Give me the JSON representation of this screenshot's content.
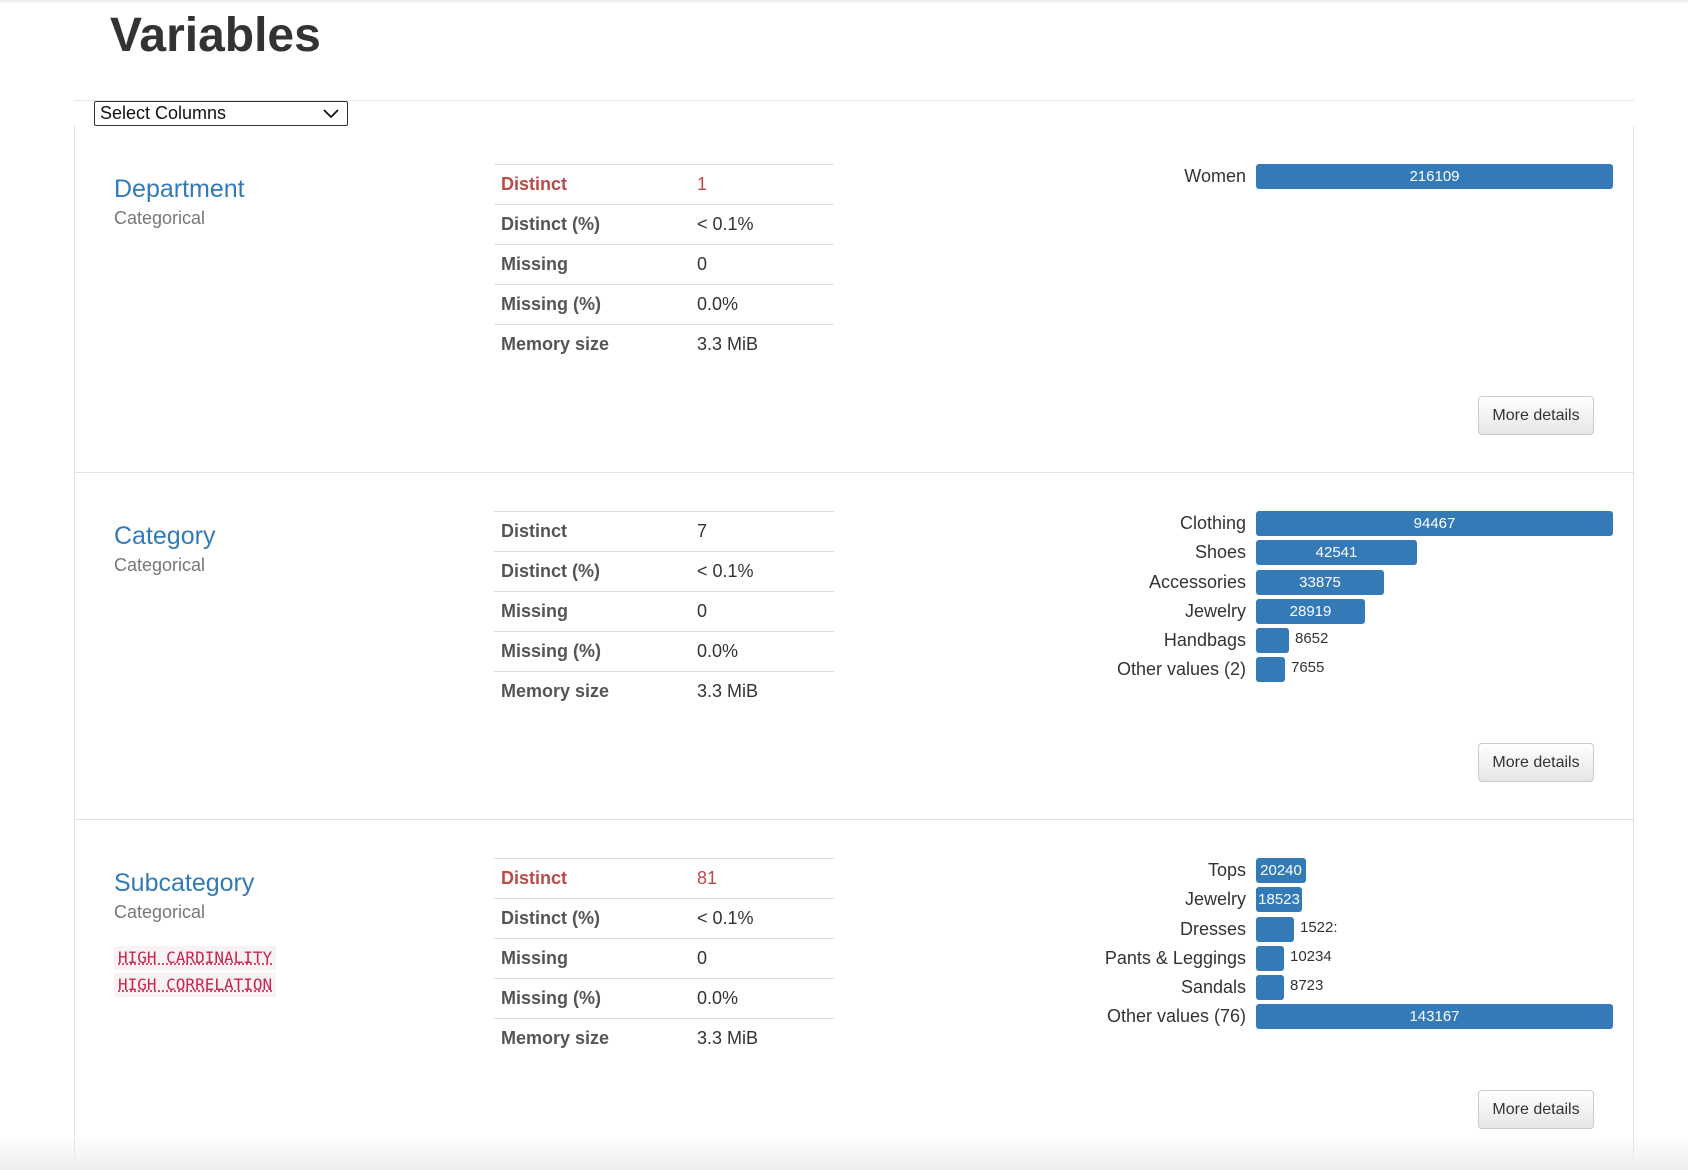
{
  "page": {
    "title": "Variables",
    "select_label": "Select Columns",
    "more_details_label": "More details"
  },
  "colors": {
    "link": "#337ab7",
    "bar": "#337ab7",
    "warning": "#b94a48",
    "alert": "#c7254e"
  },
  "variables": [
    {
      "name": "Department",
      "type": "Categorical",
      "alerts": [],
      "stats": [
        {
          "label": "Distinct",
          "value": "1",
          "warn": true
        },
        {
          "label": "Distinct (%)",
          "value": "< 0.1%",
          "warn": false
        },
        {
          "label": "Missing",
          "value": "0",
          "warn": false
        },
        {
          "label": "Missing (%)",
          "value": "0.0%",
          "warn": false
        },
        {
          "label": "Memory size",
          "value": "3.3 MiB",
          "warn": false
        }
      ],
      "frequencies": [
        {
          "label": "Women",
          "count": 216109,
          "display": "216109"
        }
      ]
    },
    {
      "name": "Category",
      "type": "Categorical",
      "alerts": [],
      "stats": [
        {
          "label": "Distinct",
          "value": "7",
          "warn": false
        },
        {
          "label": "Distinct (%)",
          "value": "< 0.1%",
          "warn": false
        },
        {
          "label": "Missing",
          "value": "0",
          "warn": false
        },
        {
          "label": "Missing (%)",
          "value": "0.0%",
          "warn": false
        },
        {
          "label": "Memory size",
          "value": "3.3 MiB",
          "warn": false
        }
      ],
      "frequencies": [
        {
          "label": "Clothing",
          "count": 94467,
          "display": "94467"
        },
        {
          "label": "Shoes",
          "count": 42541,
          "display": "42541"
        },
        {
          "label": "Accessories",
          "count": 33875,
          "display": "33875"
        },
        {
          "label": "Jewelry",
          "count": 28919,
          "display": "28919"
        },
        {
          "label": "Handbags",
          "count": 8652,
          "display": "8652"
        },
        {
          "label": "Other values (2)",
          "count": 7655,
          "display": "7655"
        }
      ]
    },
    {
      "name": "Subcategory",
      "type": "Categorical",
      "alerts": [
        "HIGH CARDINALITY",
        "HIGH CORRELATION"
      ],
      "stats": [
        {
          "label": "Distinct",
          "value": "81",
          "warn": true
        },
        {
          "label": "Distinct (%)",
          "value": "< 0.1%",
          "warn": false
        },
        {
          "label": "Missing",
          "value": "0",
          "warn": false
        },
        {
          "label": "Missing (%)",
          "value": "0.0%",
          "warn": false
        },
        {
          "label": "Memory size",
          "value": "3.3 MiB",
          "warn": false
        }
      ],
      "frequencies": [
        {
          "label": "Tops",
          "count": 20240,
          "display": "20240"
        },
        {
          "label": "Jewelry",
          "count": 18523,
          "display": "18523"
        },
        {
          "label": "Dresses",
          "count": 15221,
          "display": "1522:"
        },
        {
          "label": "Pants & Leggings",
          "count": 10234,
          "display": "10234"
        },
        {
          "label": "Sandals",
          "count": 8723,
          "display": "8723"
        },
        {
          "label": "Other values (76)",
          "count": 143167,
          "display": "143167"
        }
      ]
    }
  ]
}
